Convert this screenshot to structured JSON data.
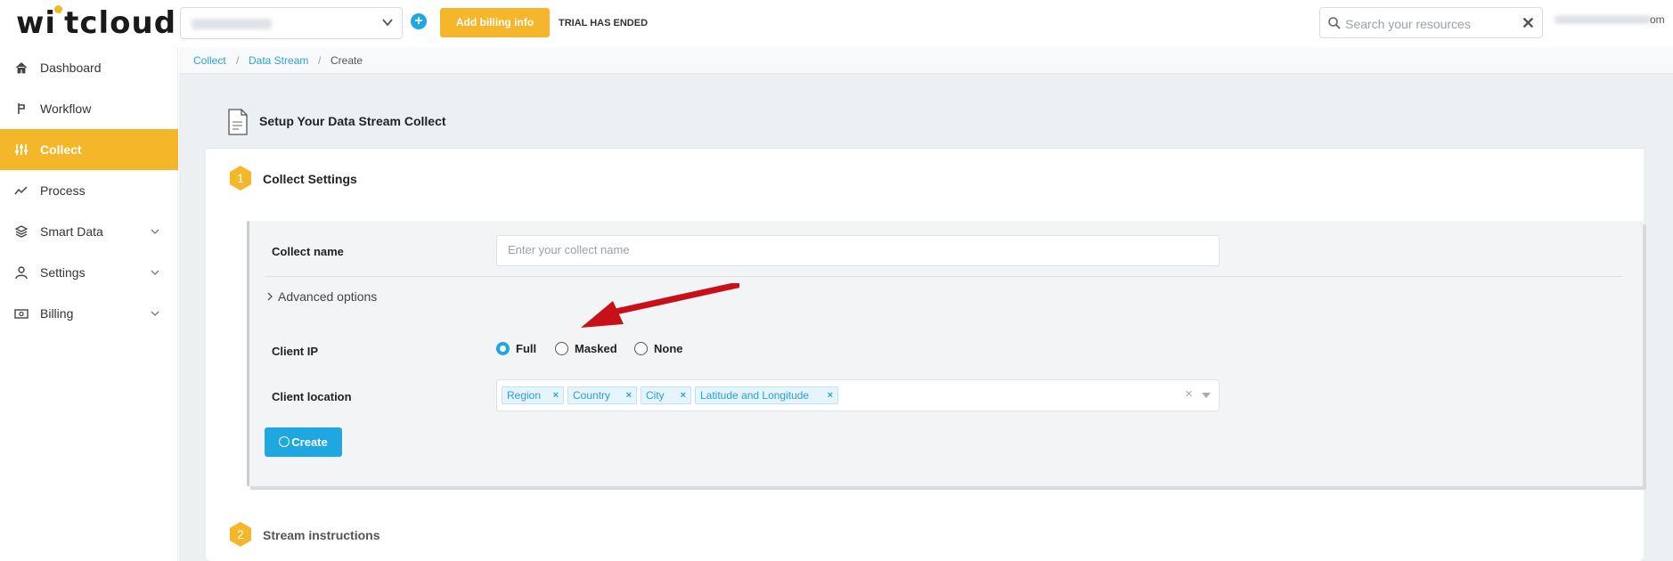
{
  "brand": {
    "logo_text": "witcloud",
    "accent": "#f4b729",
    "primary": "#1ea7e0"
  },
  "header": {
    "add_billing_label": "Add billing info",
    "trial_status": "TRIAL HAS ENDED",
    "search_placeholder": "Search your resources",
    "user_email_tail": "om"
  },
  "sidebar": {
    "items": [
      {
        "label": "Dashboard",
        "icon": "home-icon"
      },
      {
        "label": "Workflow",
        "icon": "workflow-icon"
      },
      {
        "label": "Collect",
        "icon": "sliders-icon",
        "active": true
      },
      {
        "label": "Process",
        "icon": "trend-icon"
      },
      {
        "label": "Smart Data",
        "icon": "layers-icon",
        "expandable": true
      },
      {
        "label": "Settings",
        "icon": "user-icon",
        "expandable": true
      },
      {
        "label": "Billing",
        "icon": "money-icon",
        "expandable": true
      }
    ]
  },
  "breadcrumb": {
    "items": [
      "Collect",
      "Data Stream",
      "Create"
    ]
  },
  "card": {
    "title": "Setup Your Data Stream Collect",
    "steps": [
      {
        "number": "1",
        "title": "Collect Settings"
      },
      {
        "number": "2",
        "title": "Stream instructions"
      }
    ]
  },
  "form": {
    "collect_name_label": "Collect name",
    "collect_name_placeholder": "Enter your collect name",
    "advanced_label": "Advanced options",
    "client_ip_label": "Client IP",
    "client_ip_options": [
      "Full",
      "Masked",
      "None"
    ],
    "client_ip_selected": "Full",
    "client_location_label": "Client location",
    "client_location_tags": [
      "Region",
      "Country",
      "City",
      "Latitude and Longitude"
    ],
    "create_label": "Create"
  }
}
